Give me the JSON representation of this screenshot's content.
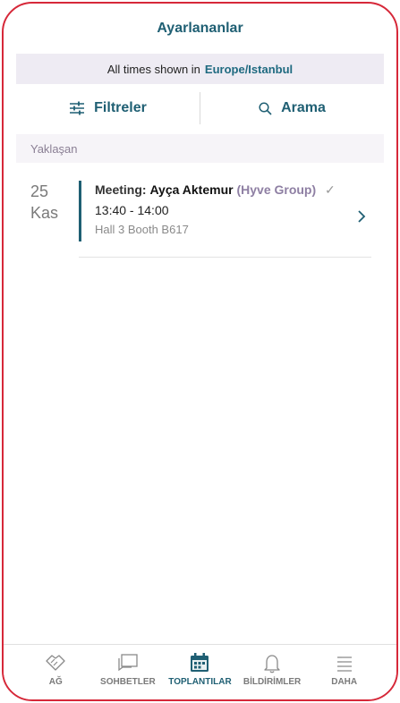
{
  "header": {
    "title": "Ayarlananlar"
  },
  "timezone": {
    "prefix": "All times shown in",
    "zone": "Europe/Istanbul"
  },
  "toolbar": {
    "filters_label": "Filtreler",
    "search_label": "Arama"
  },
  "section": {
    "label": "Yaklaşan"
  },
  "meetings": [
    {
      "day": "25",
      "month": "Kas",
      "type_label": "Meeting:",
      "person": "Ayça Aktemur",
      "org": "(Hyve Group)",
      "status": "✓",
      "time": "13:40 - 14:00",
      "location": "Hall 3 Booth B617"
    }
  ],
  "tabs": [
    {
      "label": "AĞ",
      "icon": "handshake-icon"
    },
    {
      "label": "SOHBETLER",
      "icon": "chat-icon"
    },
    {
      "label": "TOPLANTILAR",
      "icon": "calendar-icon",
      "active": true
    },
    {
      "label": "BİLDİRİMLER",
      "icon": "bell-icon"
    },
    {
      "label": "DAHA",
      "icon": "menu-icon"
    }
  ],
  "colors": {
    "accent": "#1f5f73",
    "frame": "#d62839"
  }
}
